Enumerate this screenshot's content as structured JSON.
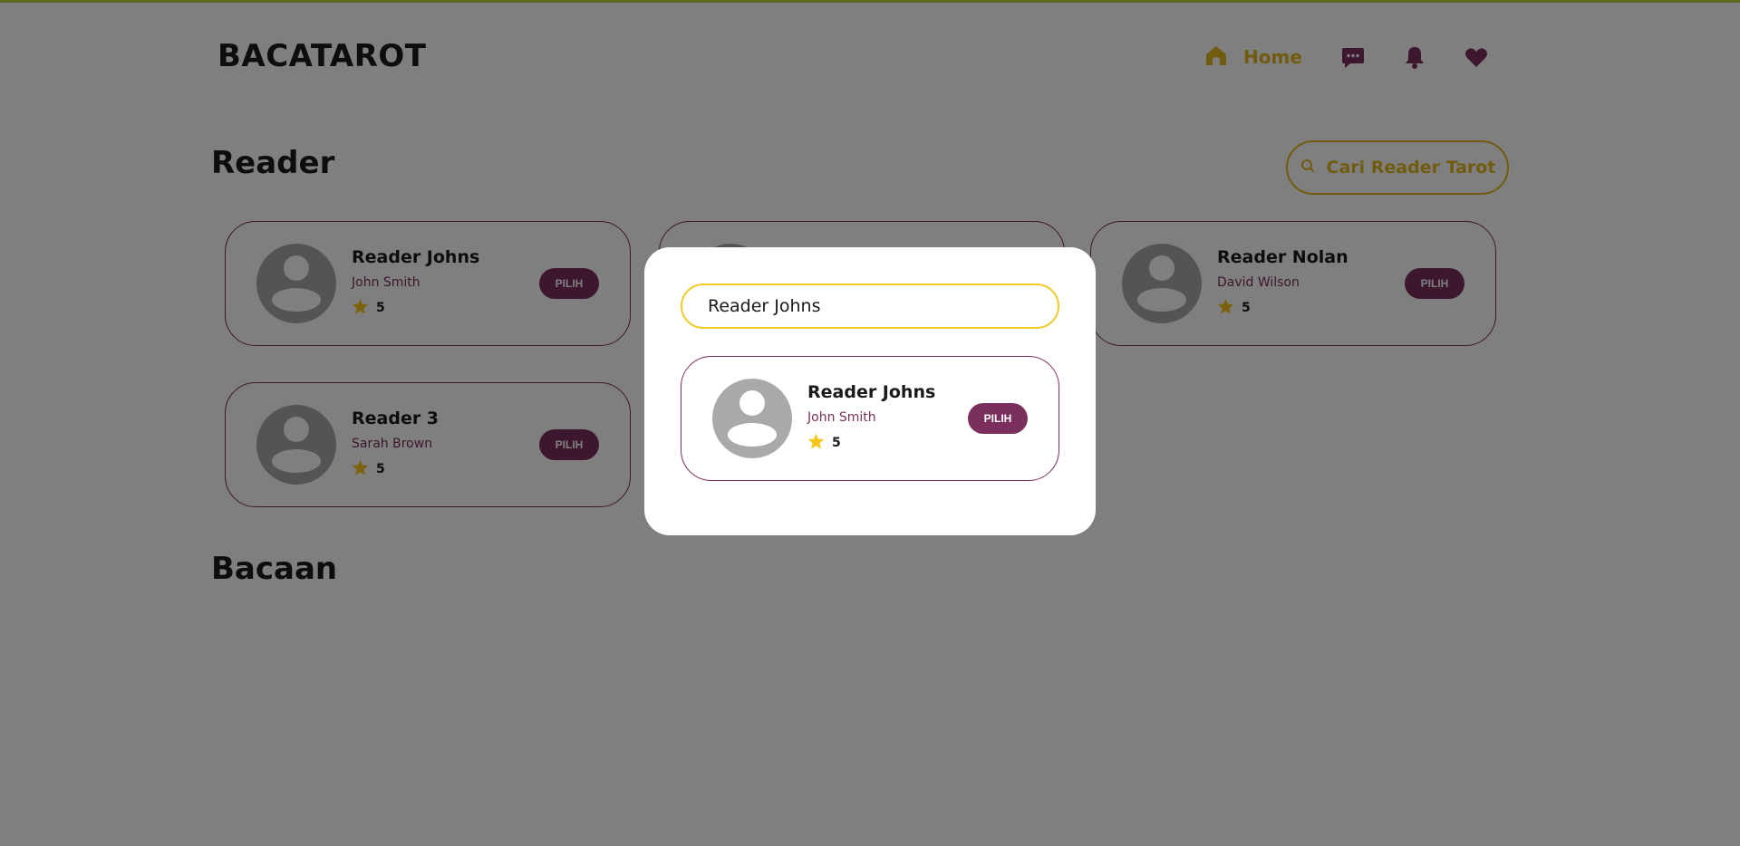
{
  "header": {
    "logo": "BACATAROT",
    "nav_home": "Home"
  },
  "sections": {
    "reader_title": "Reader",
    "bacaan_title": "Bacaan"
  },
  "search_button": {
    "label": "Cari Reader Tarot"
  },
  "readers": [
    {
      "name": "Reader Johns",
      "real_name": "John Smith",
      "rating": "5",
      "action": "PILIH"
    },
    {
      "name": "Reader Nolan",
      "real_name": "David Wilson",
      "rating": "5",
      "action": "PILIH"
    },
    {
      "name": "Reader 3",
      "real_name": "Sarah Brown",
      "rating": "5",
      "action": "PILIH"
    }
  ],
  "modal": {
    "search_value": "Reader Johns",
    "results": [
      {
        "name": "Reader Johns",
        "real_name": "John Smith",
        "rating": "5",
        "action": "PILIH"
      }
    ]
  },
  "colors": {
    "accent_yellow": "#e3b71f",
    "brand_plum": "#7b2f5c",
    "star": "#f5c518",
    "top_line": "#b5cf3e"
  },
  "icons": [
    "home-icon",
    "chat-icon",
    "bell-icon",
    "heart-icon",
    "search-icon",
    "star-icon",
    "avatar-icon"
  ]
}
